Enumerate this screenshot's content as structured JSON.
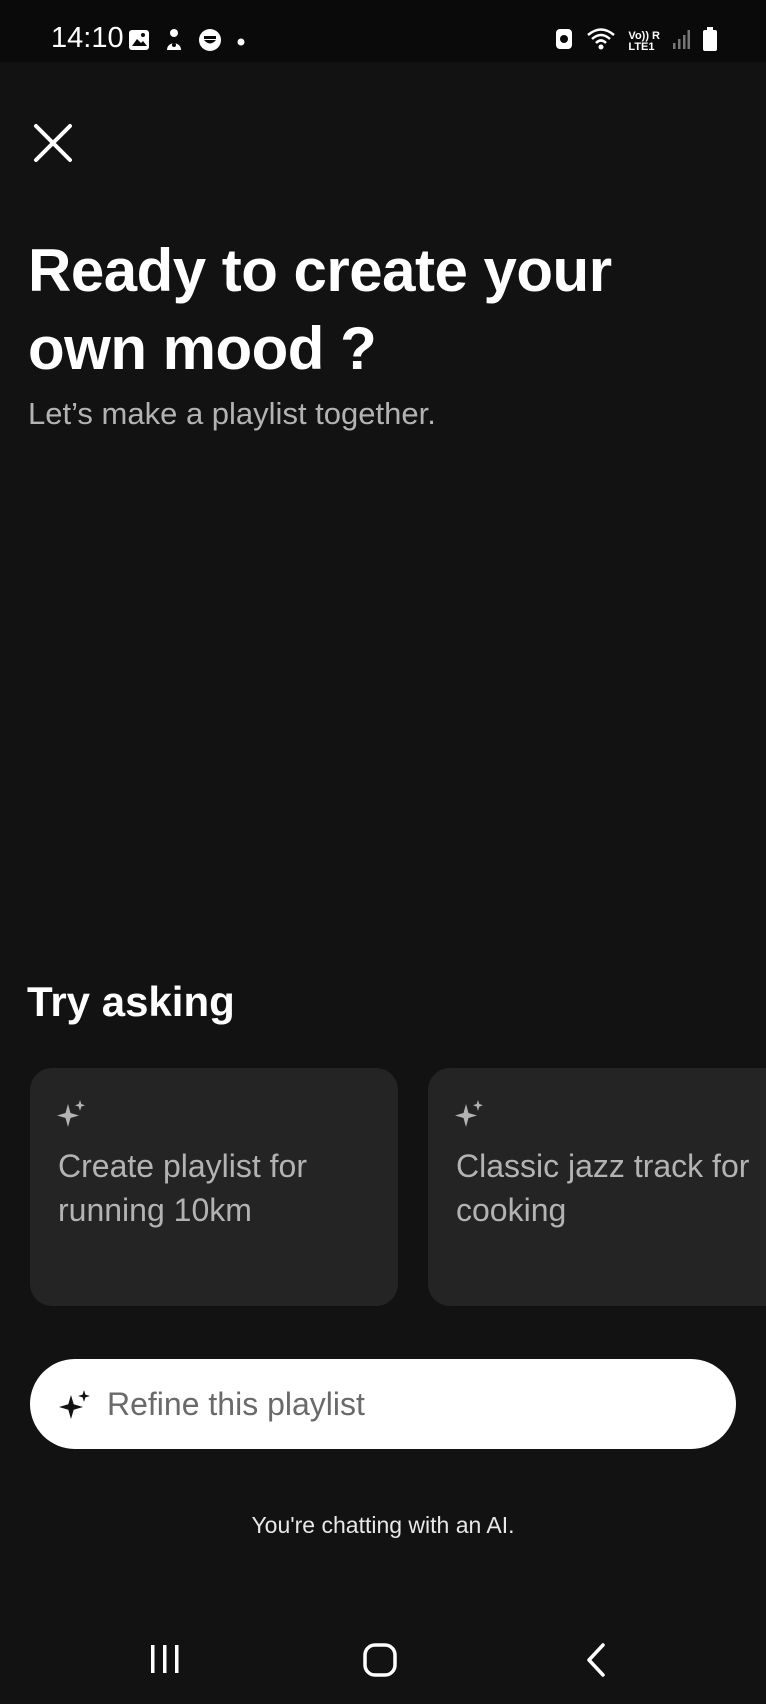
{
  "status_bar": {
    "time": "14:10",
    "left_icons": [
      "image-icon",
      "person-icon",
      "face-icon",
      "dot-icon"
    ],
    "right_icons": [
      "alarm-icon",
      "wifi-icon",
      "volte-lte-icon",
      "signal-icon",
      "battery-icon"
    ],
    "volte_label": "Vo)) R",
    "lte_label": "LTE1"
  },
  "header": {
    "close_icon": "close-icon",
    "headline": "Ready to create your own  mood ?",
    "subtitle": "Let’s make a playlist together."
  },
  "suggestions": {
    "title": "Try asking",
    "items": [
      {
        "icon": "sparkle-icon",
        "text": "Create playlist for running 10km"
      },
      {
        "icon": "sparkle-icon",
        "text": "Classic jazz track for cooking"
      }
    ]
  },
  "input": {
    "icon": "sparkle-icon",
    "placeholder": "Refine this playlist"
  },
  "footer_note": "You're chatting with an AI.",
  "nav": {
    "recents_icon": "recents-icon",
    "home_icon": "home-icon",
    "back_icon": "back-icon"
  },
  "colors": {
    "background": "#121212",
    "card": "#242424",
    "muted_text": "#b3b3b3",
    "input_bg": "#ffffff"
  }
}
